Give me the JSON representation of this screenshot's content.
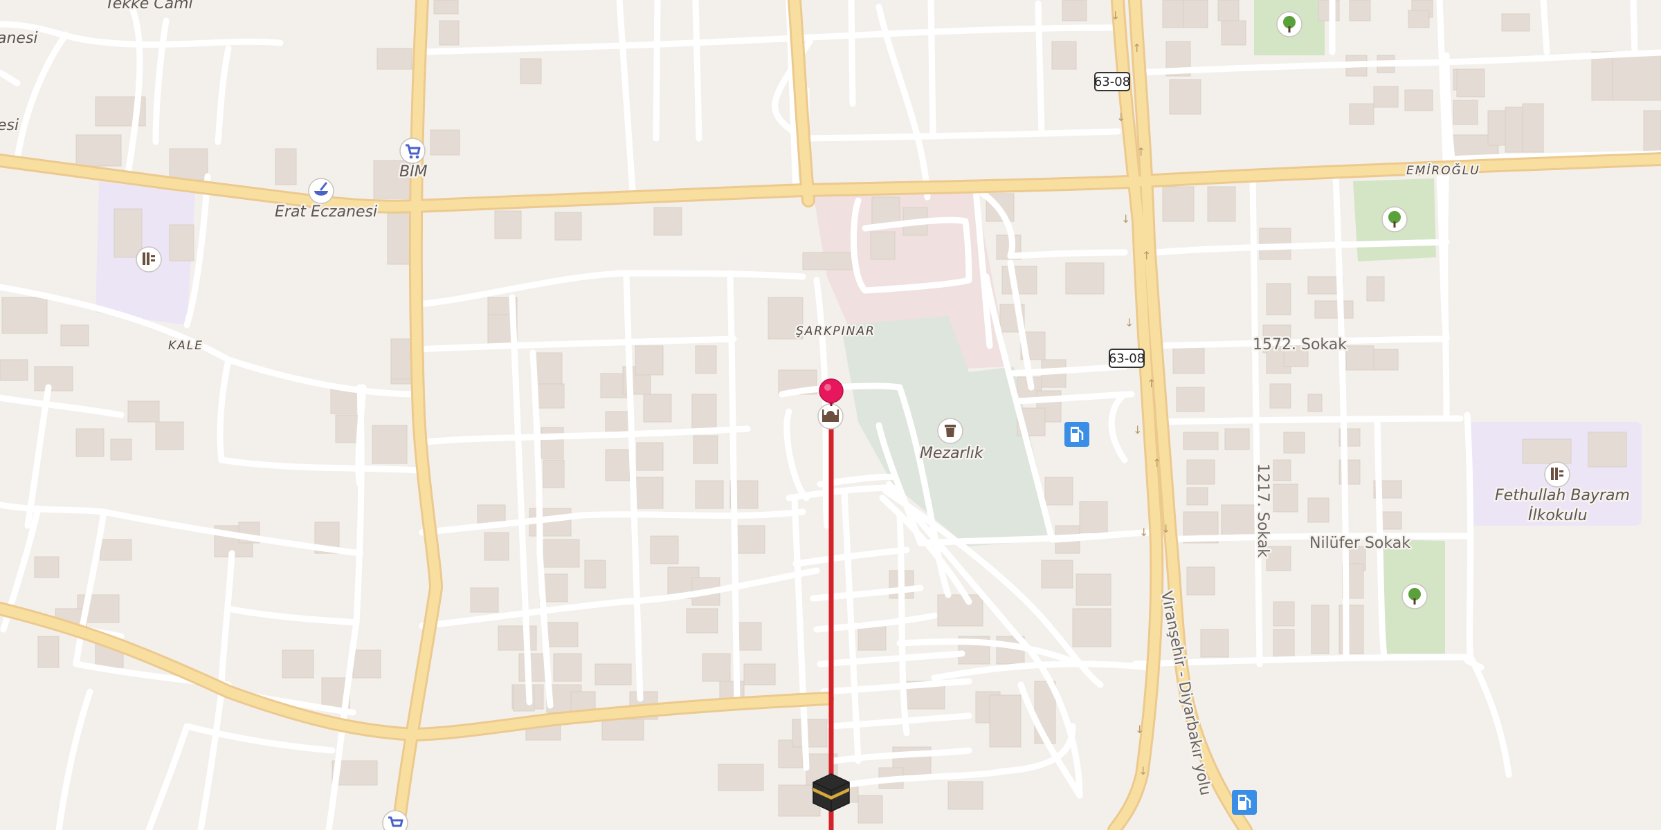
{
  "map": {
    "colors": {
      "background": "#f3f0ec",
      "building": "#e4dcd4",
      "road_minor": "#ffffff",
      "road_major": "#f8dfa0",
      "road_major_casing": "#ecc98e",
      "park": "#d3e5c5",
      "cemetery": "#dde5dc",
      "school_area": "#ebe5f6",
      "religious_area": "#f0e0e0",
      "route_line": "#d3222a",
      "pin": "#e8175d"
    },
    "labels": {
      "tekke_cami": "Tekke Cami",
      "anesi_1": "anesi",
      "anesi_2": "esi",
      "bim": "BİM",
      "erat_eczanesi": "Erat Eczanesi",
      "kale": "KALE",
      "sarkpinar": "ŞARKPINAR",
      "mezarlik": "Mezarlık",
      "emiroglu": "EMİROĞLU",
      "sokak_1572": "1572. Sokak",
      "sokak_1217": "1217. Sokak",
      "nilufer_sokak": "Nilüfer Sokak",
      "viransehir_yolu": "Viranşehir - Diyarbakır yolu",
      "fethullah_line1": "Fethullah Bayram",
      "fethullah_line2": "İlkokulu"
    },
    "road_shields": [
      "63-08",
      "63-08"
    ],
    "icons": {
      "shopping": "shopping-cart-icon",
      "pharmacy": "pharmacy-mortar-icon",
      "school": "school-icon",
      "park": "tree-icon",
      "cemetery": "cemetery-urn-icon",
      "fuel": "fuel-pump-icon",
      "mosque": "mosque-icon",
      "kaaba": "kaaba-icon",
      "pin": "location-pin-icon"
    }
  }
}
